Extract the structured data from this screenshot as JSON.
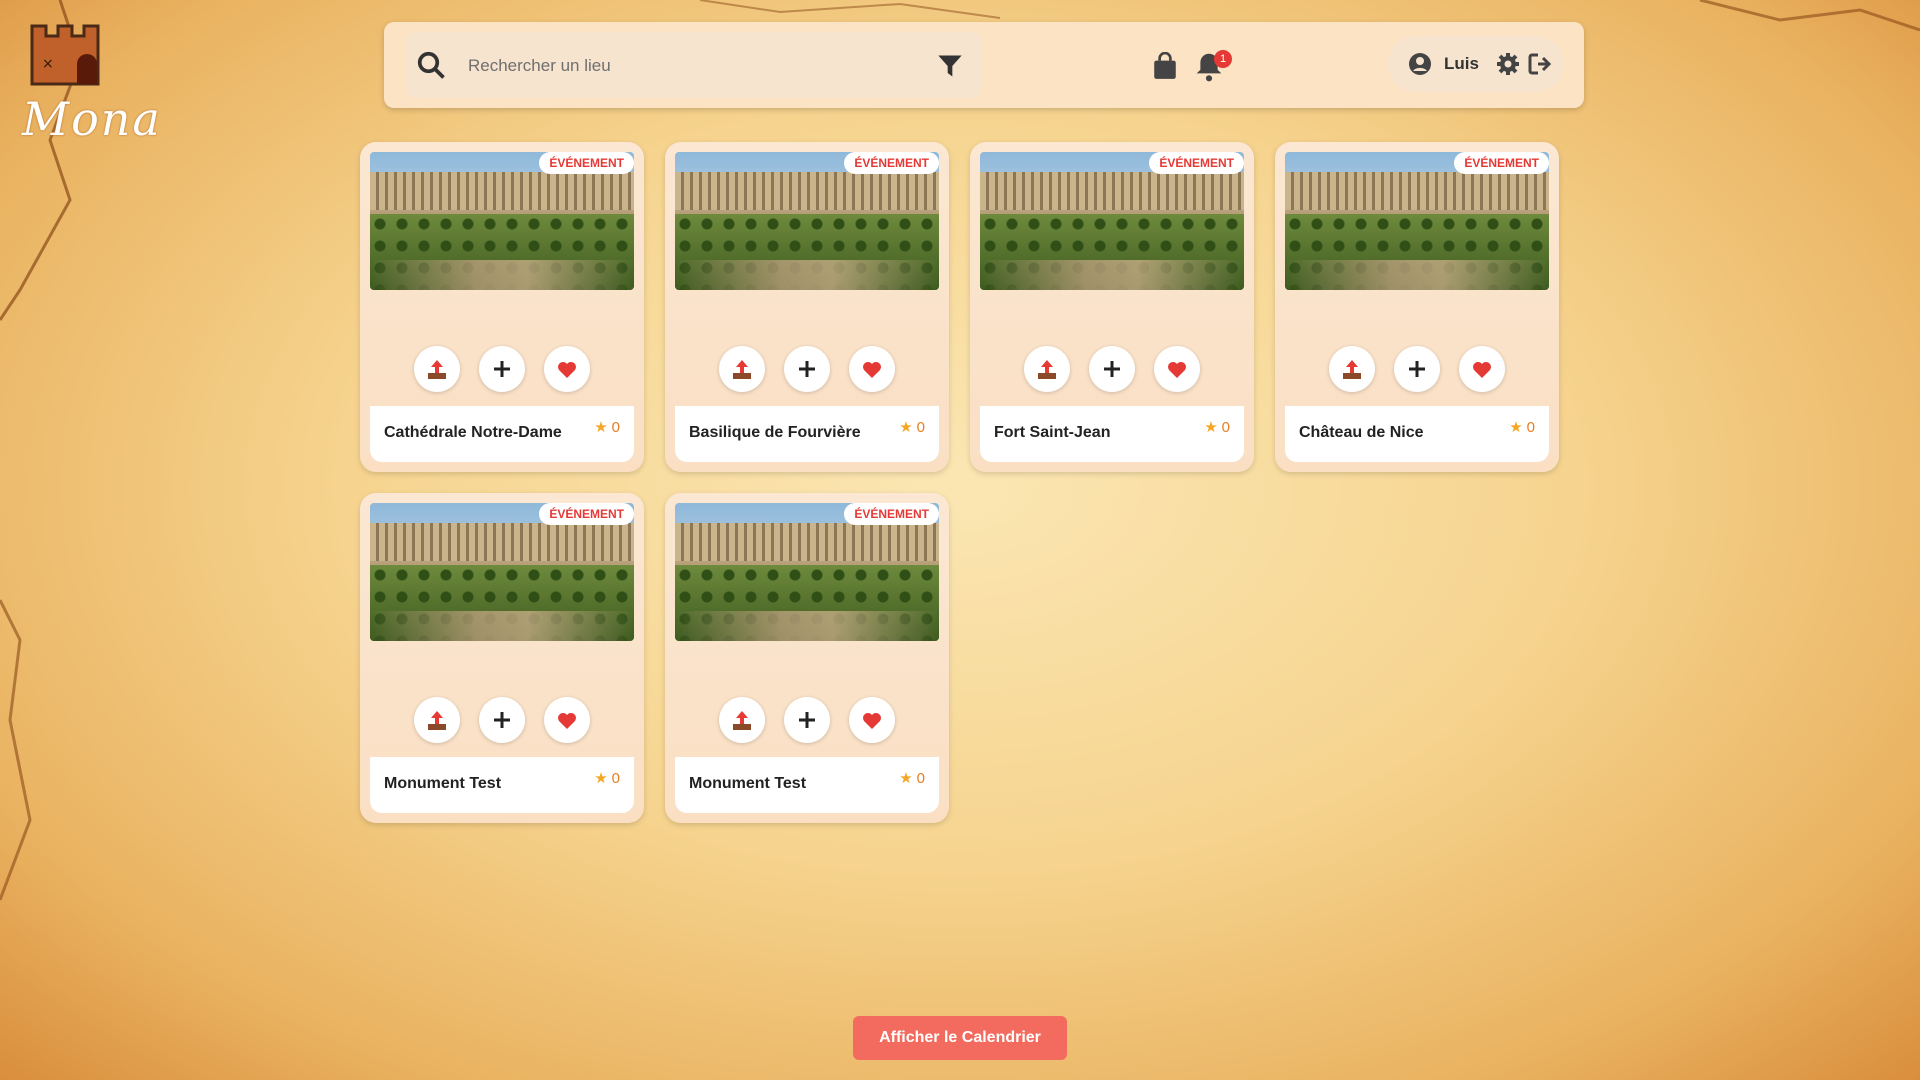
{
  "app": {
    "name": "Mona"
  },
  "header": {
    "search_placeholder": "Rechercher un lieu",
    "notifications_count": "1",
    "user_name": "Luis",
    "icons": [
      "search-icon",
      "filter-icon",
      "bag-icon",
      "bell-icon",
      "user-icon",
      "gear-icon",
      "logout-icon"
    ]
  },
  "cards": [
    {
      "tag": "ÉVÉNEMENT",
      "title": "Cathédrale Notre-Dame",
      "rating": "0"
    },
    {
      "tag": "ÉVÉNEMENT",
      "title": "Basilique de Fourvière",
      "rating": "0"
    },
    {
      "tag": "ÉVÉNEMENT",
      "title": "Fort Saint-Jean",
      "rating": "0"
    },
    {
      "tag": "ÉVÉNEMENT",
      "title": "Château de Nice",
      "rating": "0"
    },
    {
      "tag": "ÉVÉNEMENT",
      "title": "Monument Test",
      "rating": "0"
    },
    {
      "tag": "ÉVÉNEMENT",
      "title": "Monument Test",
      "rating": "0"
    }
  ],
  "footer": {
    "calendar_button": "Afficher le Calendrier"
  },
  "colors": {
    "accent": "#f26b5e",
    "tag": "#e53935",
    "star": "#f5a623",
    "heart": "#e53935"
  }
}
